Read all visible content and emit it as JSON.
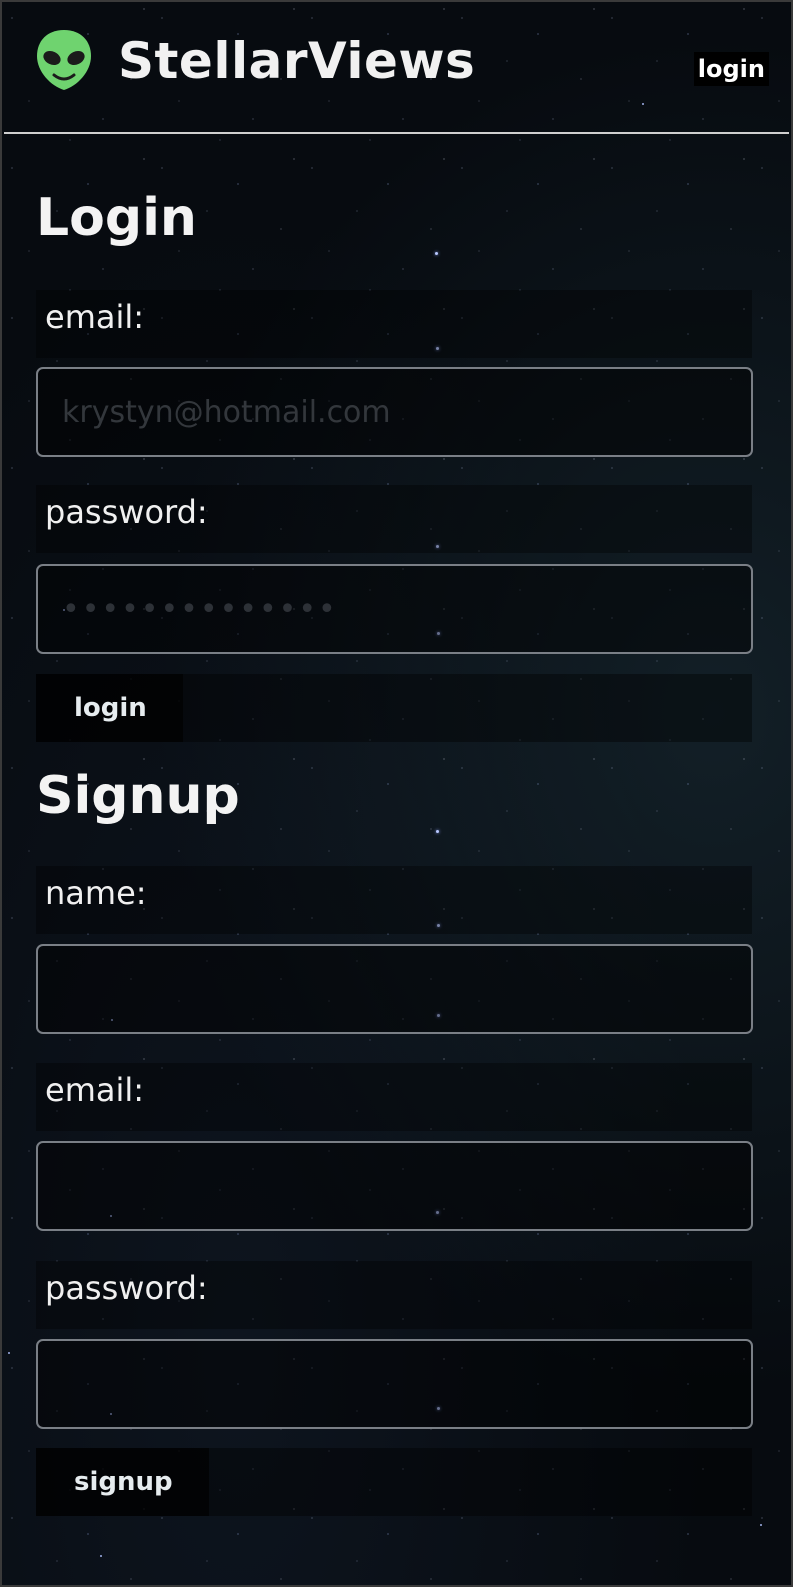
{
  "header": {
    "brand": "StellarViews",
    "nav_login_label": "login",
    "logo_icon": "alien-head-icon",
    "accent_color": "#6fd36f"
  },
  "login": {
    "title": "Login",
    "email_label": "email:",
    "email_placeholder": "krystyn@hotmail.com",
    "password_label": "password:",
    "password_placeholder": "••••••••••••••",
    "submit_label": "login"
  },
  "signup": {
    "title": "Signup",
    "name_label": "name:",
    "name_placeholder": "",
    "email_label": "email:",
    "email_placeholder": "",
    "password_label": "password:",
    "password_placeholder": "",
    "submit_label": "signup"
  }
}
